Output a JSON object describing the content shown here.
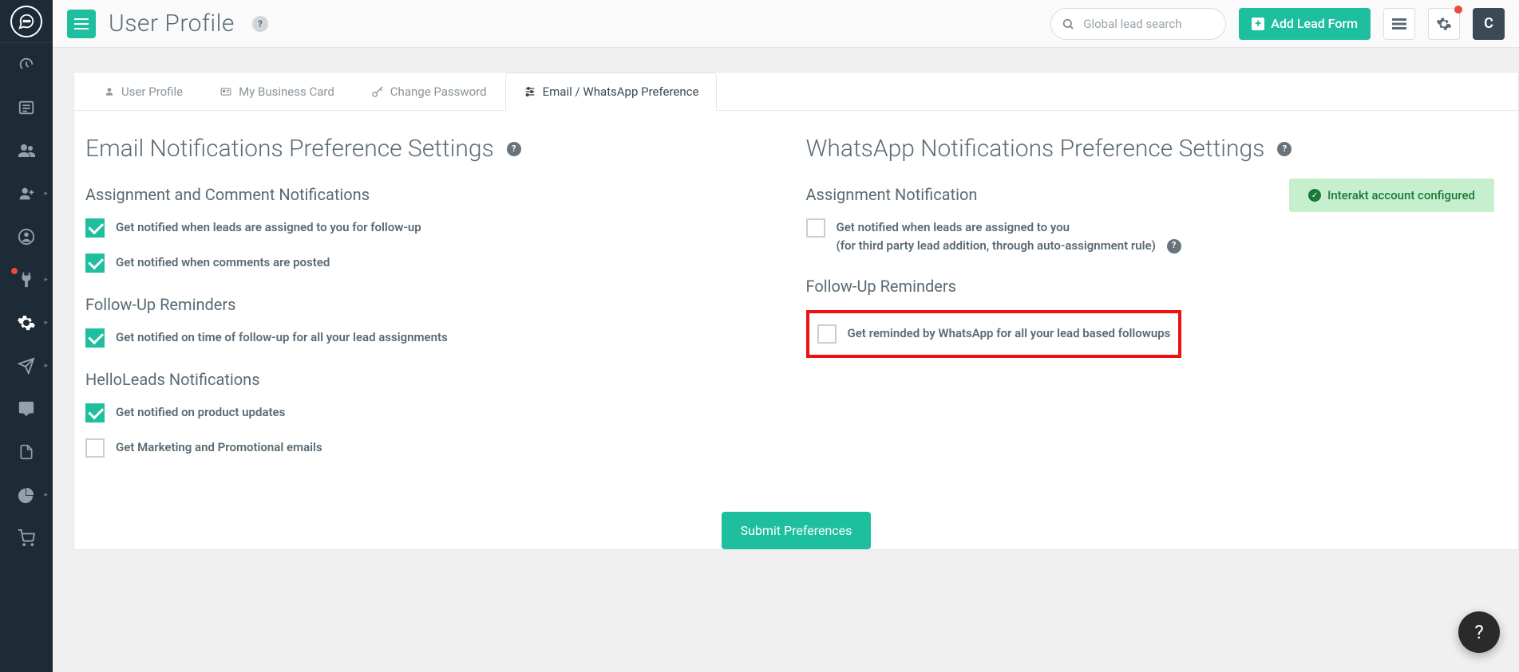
{
  "header": {
    "page_title": "User Profile",
    "search_placeholder": "Global lead search",
    "add_lead_label": "Add Lead Form",
    "avatar_letter": "C"
  },
  "tabs": [
    {
      "label": "User Profile",
      "icon": "user-icon"
    },
    {
      "label": "My Business Card",
      "icon": "card-icon"
    },
    {
      "label": "Change Password",
      "icon": "key-icon"
    },
    {
      "label": "Email / WhatsApp Preference",
      "icon": "sliders-icon"
    }
  ],
  "email_section": {
    "title": "Email Notifications Preference Settings",
    "groups": [
      {
        "title": "Assignment and Comment Notifications",
        "items": [
          {
            "label": "Get notified when leads are assigned to you for follow-up",
            "checked": true
          },
          {
            "label": "Get notified when comments are posted",
            "checked": true
          }
        ]
      },
      {
        "title": "Follow-Up Reminders",
        "items": [
          {
            "label": "Get notified on time of follow-up for all your lead assignments",
            "checked": true
          }
        ]
      },
      {
        "title": "HelloLeads Notifications",
        "items": [
          {
            "label": "Get notified on product updates",
            "checked": true
          },
          {
            "label": "Get Marketing and Promotional emails",
            "checked": false
          }
        ]
      }
    ]
  },
  "whatsapp_section": {
    "title": "WhatsApp Notifications Preference Settings",
    "status_badge": "Interakt account configured",
    "groups": [
      {
        "title": "Assignment Notification",
        "items": [
          {
            "label": "Get notified when leads are assigned to you",
            "sublabel": "(for third party lead addition, through auto-assignment rule)",
            "checked": false,
            "help": true
          }
        ]
      },
      {
        "title": "Follow-Up Reminders",
        "items": [
          {
            "label": "Get reminded by WhatsApp for all your lead based followups",
            "checked": false,
            "highlighted": true
          }
        ]
      }
    ]
  },
  "submit_label": "Submit Preferences",
  "floating_help": "?"
}
